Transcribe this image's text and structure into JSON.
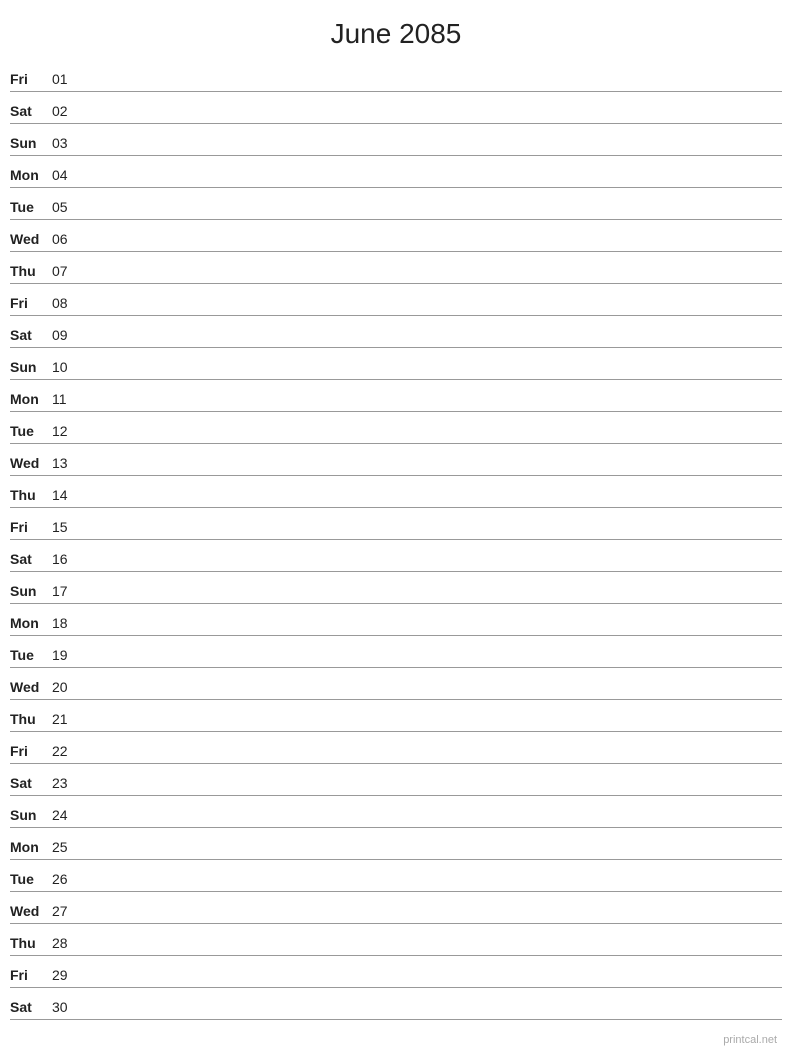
{
  "title": "June 2085",
  "footer": "printcal.net",
  "days": [
    {
      "name": "Fri",
      "number": "01"
    },
    {
      "name": "Sat",
      "number": "02"
    },
    {
      "name": "Sun",
      "number": "03"
    },
    {
      "name": "Mon",
      "number": "04"
    },
    {
      "name": "Tue",
      "number": "05"
    },
    {
      "name": "Wed",
      "number": "06"
    },
    {
      "name": "Thu",
      "number": "07"
    },
    {
      "name": "Fri",
      "number": "08"
    },
    {
      "name": "Sat",
      "number": "09"
    },
    {
      "name": "Sun",
      "number": "10"
    },
    {
      "name": "Mon",
      "number": "11"
    },
    {
      "name": "Tue",
      "number": "12"
    },
    {
      "name": "Wed",
      "number": "13"
    },
    {
      "name": "Thu",
      "number": "14"
    },
    {
      "name": "Fri",
      "number": "15"
    },
    {
      "name": "Sat",
      "number": "16"
    },
    {
      "name": "Sun",
      "number": "17"
    },
    {
      "name": "Mon",
      "number": "18"
    },
    {
      "name": "Tue",
      "number": "19"
    },
    {
      "name": "Wed",
      "number": "20"
    },
    {
      "name": "Thu",
      "number": "21"
    },
    {
      "name": "Fri",
      "number": "22"
    },
    {
      "name": "Sat",
      "number": "23"
    },
    {
      "name": "Sun",
      "number": "24"
    },
    {
      "name": "Mon",
      "number": "25"
    },
    {
      "name": "Tue",
      "number": "26"
    },
    {
      "name": "Wed",
      "number": "27"
    },
    {
      "name": "Thu",
      "number": "28"
    },
    {
      "name": "Fri",
      "number": "29"
    },
    {
      "name": "Sat",
      "number": "30"
    }
  ]
}
